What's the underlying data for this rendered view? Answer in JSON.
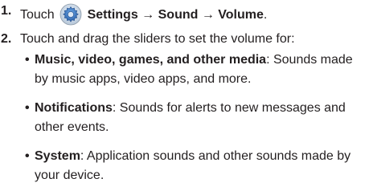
{
  "step1": {
    "number": "1.",
    "prefix": "Touch",
    "icon": "settings-gear-icon",
    "path": "Settings → Sound → Volume",
    "end": "."
  },
  "step2": {
    "number": "2.",
    "text": "Touch and drag the sliders to set the volume for:"
  },
  "bullets": [
    {
      "term": "Music",
      "term_sep": ", ",
      "term_rest": "video, games, and other media",
      "desc": ": Sounds made by music apps, video apps, and more."
    },
    {
      "term": "Notifications",
      "desc": ": Sounds for alerts to new messages and other events."
    },
    {
      "term": "System",
      "desc": ": Application sounds and other sounds made by your device."
    }
  ],
  "colors": {
    "text": "#231f20",
    "icon_blue": "#3a78c2"
  }
}
